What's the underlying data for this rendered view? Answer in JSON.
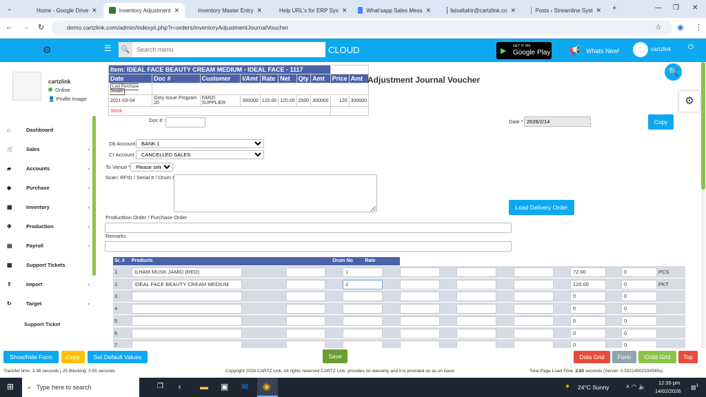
{
  "browser": {
    "tabs": [
      {
        "label": "Home - Google Drive",
        "color": "#1fa463"
      },
      {
        "label": "Inventory Adjustment",
        "color": "#2e7d32",
        "active": true
      },
      {
        "label": "Inventory Master Entry",
        "color": "#4285f4"
      },
      {
        "label": "Help URL's for ERP Sys",
        "color": "#4285f4"
      },
      {
        "label": "What'sapp Sales Mess",
        "color": "#4285f4"
      },
      {
        "label": "faisaltahir@cartzlink.co",
        "color": "#1565c0"
      },
      {
        "label": "Posts ‹ Streamline Syst",
        "color": "#5c8fc7"
      }
    ],
    "new_tab": "+",
    "url": "demo.cartzlink.com/admin/indexyii.php?r=orders/inventoryAdjustmentJournalVoucher"
  },
  "header": {
    "search_placeholder": "Search menu",
    "cloud": "CLOUD",
    "google_play_small": "GET IT ON",
    "google_play": "Google Play",
    "whats_new": "Whats New!",
    "user": "cartzlink"
  },
  "sidebar": {
    "username": "cartzlink",
    "status": "Online",
    "profile": "Profile Image",
    "items": [
      {
        "label": "Dashboard",
        "icon": "⌂",
        "chev": false
      },
      {
        "label": "Sales",
        "icon": "🛒",
        "chev": true
      },
      {
        "label": "Accounts",
        "icon": "▰",
        "chev": true
      },
      {
        "label": "Purchase",
        "icon": "◆",
        "chev": true
      },
      {
        "label": "Inventory",
        "icon": "▦",
        "chev": true
      },
      {
        "label": "Production",
        "icon": "✥",
        "chev": true
      },
      {
        "label": "Payroll",
        "icon": "▤",
        "chev": true
      },
      {
        "label": "Support Tickets",
        "icon": "▩",
        "chev": false
      },
      {
        "label": "Import",
        "icon": "⇪",
        "chev": true
      },
      {
        "label": "Target",
        "icon": "↻",
        "chev": true
      }
    ],
    "support_ticket": "Support Ticket"
  },
  "item_popup": {
    "title": "Item: IDEAL FACE BEAUTY CREAM MEDIUM - IDEAL FACE - 1117",
    "headers": [
      "Date",
      "Doc #",
      "Customer",
      "I/Amt",
      "Rate",
      "Net",
      "Qty",
      "Amt",
      "Price",
      "Amt"
    ],
    "last_purchase_btn": "Last Purchase Details",
    "row": [
      "2021-03-04",
      "Grey Issue Program 20",
      "FARZI SUPPLIER",
      "300000",
      "120.00",
      "120.00",
      "2500",
      "300000",
      "120",
      "300000"
    ],
    "stock": "Stock :"
  },
  "form": {
    "title": "Adjustment Journal Voucher",
    "doc_label": "Doc # :",
    "doc_value": "",
    "date_label": "Date *",
    "date_value": "2026/2/14",
    "copy": "Copy",
    "db_label": "Db Account",
    "db_value": "BANK 1",
    "cr_label": "Cr Account",
    "cr_value": "CANCELLED SALES",
    "venue_label": "To Venue *",
    "venue_value": "Please select",
    "scan_label": "Scan: RFID / Serial # / Drum #",
    "load_delivery": "Load Delivery Order",
    "prod_label": "Producttion Order / Purchase Order",
    "remarks_label": "Remarks"
  },
  "grid": {
    "headers": [
      "Sr. #",
      "Products",
      "Drum No",
      "Rate"
    ],
    "rows": [
      {
        "sr": "1",
        "product": "ILHAM MUSK JAMID (RED)",
        "drum": "",
        "rate": "1",
        "price": "72.00",
        "qty": "0",
        "unit": "PCS"
      },
      {
        "sr": "2",
        "product": "IDEAL FACE BEAUTY CREAM MEDIUM",
        "drum": "",
        "rate": "2",
        "price": "120.00",
        "qty": "0",
        "unit": "PKT"
      },
      {
        "sr": "3",
        "product": "",
        "drum": "",
        "rate": "",
        "price": "0",
        "qty": "0",
        "unit": ""
      },
      {
        "sr": "4",
        "product": "",
        "drum": "",
        "rate": "",
        "price": "0",
        "qty": "0",
        "unit": ""
      },
      {
        "sr": "5",
        "product": "",
        "drum": "",
        "rate": "",
        "price": "0",
        "qty": "0",
        "unit": ""
      },
      {
        "sr": "6",
        "product": "",
        "drum": "",
        "rate": "",
        "price": "0",
        "qty": "0",
        "unit": ""
      },
      {
        "sr": "7",
        "product": "",
        "drum": "",
        "rate": "",
        "price": "0",
        "qty": "0",
        "unit": ""
      }
    ]
  },
  "footer": {
    "show_hide": "Show/hide Form",
    "copy": "Copy",
    "set_default": "Set Default Values",
    "save": "Save",
    "data_grid": "Data Grid",
    "form": "Form",
    "child_grid": "Child Grid",
    "top": "Top",
    "transfer": "Transfer time: 3.38 seconds | JS Blocking: 0.55 seconds",
    "copyright": "Copyright 2026 CARTZ Link. All rights reserved CARTZ Link. provides no warranty and it is provided on as on basis",
    "load_prefix": "Total Page Load Time: ",
    "load_time": "2.83",
    "load_suffix": " seconds (Server: 0.53214502334595s)"
  },
  "taskbar": {
    "search": "Type here to search",
    "weather": "24°C  Sunny",
    "time": "12:35 pm",
    "date": "14/02/2026",
    "notif": "1"
  }
}
